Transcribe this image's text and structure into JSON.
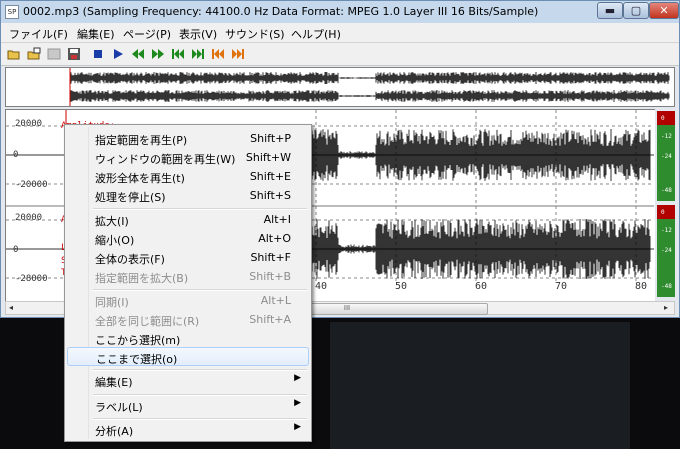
{
  "window": {
    "title": "0002.mp3  (Sampling Frequency: 44100.0 Hz  Data Format: MPEG 1.0 Layer III  16 Bits/Sample)",
    "app_icon_text": "SP",
    "controls": {
      "minimize": "▬",
      "maximize": "▢",
      "close": "✕"
    }
  },
  "menubar": [
    {
      "label": "ファイル(F)"
    },
    {
      "label": "編集(E)"
    },
    {
      "label": "ページ(P)"
    },
    {
      "label": "表示(V)"
    },
    {
      "label": "サウンド(S)"
    },
    {
      "label": "ヘルプ(H)"
    }
  ],
  "toolbar": {
    "icons": [
      "open-folder-icon",
      "open-recent-icon",
      "disabled-save-icon",
      "save-icon",
      "stop-icon",
      "play-icon",
      "rewind-icon",
      "fast-forward-icon",
      "skip-start-icon",
      "skip-end-icon",
      "skip-back-orange-icon",
      "skip-forward-orange-icon"
    ]
  },
  "waveform": {
    "y_ticks_top": [
      "20000",
      "0",
      "-20000"
    ],
    "y_ticks_bottom": [
      "20000",
      "0",
      "-28000"
    ],
    "amplitude_label": "Amplitude:",
    "amp_short": "A",
    "side_letters": [
      "L",
      "S",
      "T"
    ],
    "x_ticks": [
      "40",
      "50",
      "60",
      "70",
      "80"
    ],
    "meter_labels_top": [
      "0",
      "-12",
      "-24",
      "-48"
    ],
    "meter_labels_bottom": [
      "0",
      "-12",
      "-24",
      "-48"
    ],
    "colors": {
      "waveform": "#000000",
      "meter_green": "#2e8b2e",
      "meter_red": "#b00000",
      "label_red": "#cc0000"
    }
  },
  "hscroll": {
    "thumb_glyph": "III",
    "left_arrow": "◂",
    "right_arrow": "▸"
  },
  "context_menu": {
    "items": [
      {
        "label": "指定範囲を再生(P)",
        "shortcut": "Shift+P",
        "disabled": false
      },
      {
        "label": "ウィンドウの範囲を再生(W)",
        "shortcut": "Shift+W",
        "disabled": false
      },
      {
        "label": "波形全体を再生(t)",
        "shortcut": "Shift+E",
        "disabled": false
      },
      {
        "label": "処理を停止(S)",
        "shortcut": "Shift+S",
        "disabled": false
      },
      {
        "label": "拡大(I)",
        "shortcut": "Alt+I",
        "disabled": false
      },
      {
        "label": "縮小(O)",
        "shortcut": "Alt+O",
        "disabled": false
      },
      {
        "label": "全体の表示(F)",
        "shortcut": "Shift+F",
        "disabled": false
      },
      {
        "label": "指定範囲を拡大(B)",
        "shortcut": "Shift+B",
        "disabled": true
      },
      {
        "label": "同期(I)",
        "shortcut": "Alt+L",
        "disabled": true
      },
      {
        "label": "全部を同じ範囲に(R)",
        "shortcut": "Shift+A",
        "disabled": true
      },
      {
        "label": "ここから選択(m)",
        "shortcut": "",
        "disabled": false
      },
      {
        "label": "ここまで選択(o)",
        "shortcut": "",
        "disabled": false,
        "highlighted": true
      },
      {
        "label": "編集(E)",
        "submenu": true
      },
      {
        "label": "ラベル(L)",
        "submenu": true
      },
      {
        "label": "分析(A)",
        "submenu": true
      }
    ],
    "submenu_arrow": "▶"
  }
}
